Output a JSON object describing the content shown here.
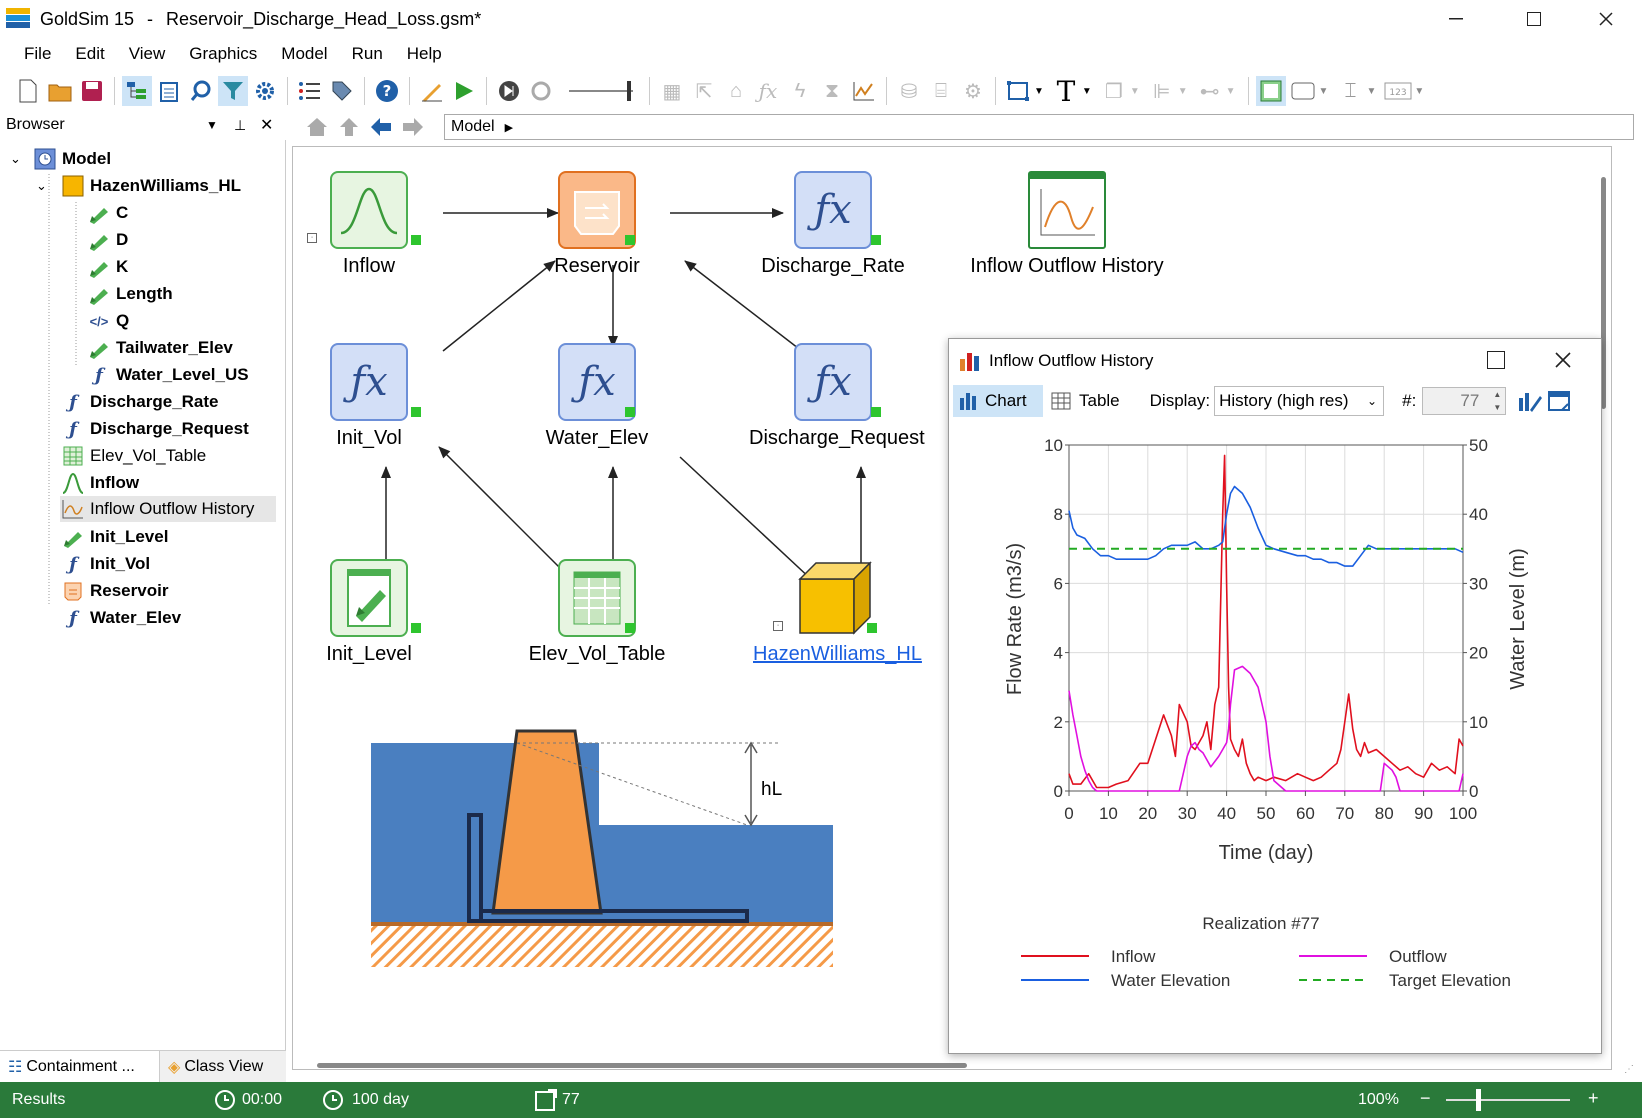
{
  "window": {
    "app_title": "GoldSim 15",
    "file": "Reservoir_Discharge_Head_Loss.gsm*"
  },
  "menu": [
    "File",
    "Edit",
    "View",
    "Graphics",
    "Model",
    "Run",
    "Help"
  ],
  "browser": {
    "title": "Browser",
    "tree": [
      {
        "label": "Model",
        "level": 0,
        "icon": "model-icon",
        "bold": true
      },
      {
        "label": "HazenWilliams_HL",
        "level": 1,
        "icon": "container-icon",
        "bold": true
      },
      {
        "label": "C",
        "level": 2,
        "icon": "data-pencil-icon",
        "bold": true
      },
      {
        "label": "D",
        "level": 2,
        "icon": "data-pencil-icon",
        "bold": true
      },
      {
        "label": "K",
        "level": 2,
        "icon": "data-pencil-icon",
        "bold": true
      },
      {
        "label": "Length",
        "level": 2,
        "icon": "data-pencil-icon",
        "bold": true
      },
      {
        "label": "Q",
        "level": 2,
        "icon": "script-icon",
        "bold": true
      },
      {
        "label": "Tailwater_Elev",
        "level": 2,
        "icon": "data-pencil-icon",
        "bold": true
      },
      {
        "label": "Water_Level_US",
        "level": 2,
        "icon": "expression-icon",
        "bold": true
      },
      {
        "label": "Discharge_Rate",
        "level": 1,
        "icon": "expression-icon",
        "bold": true
      },
      {
        "label": "Discharge_Request",
        "level": 1,
        "icon": "expression-icon",
        "bold": true
      },
      {
        "label": "Elev_Vol_Table",
        "level": 1,
        "icon": "table-icon",
        "bold": false
      },
      {
        "label": "Inflow",
        "level": 1,
        "icon": "timeseries-icon",
        "bold": true
      },
      {
        "label": "Inflow Outflow History",
        "level": 1,
        "icon": "chart-icon",
        "bold": false,
        "selected": true
      },
      {
        "label": "Init_Level",
        "level": 1,
        "icon": "data-pencil-icon",
        "bold": true
      },
      {
        "label": "Init_Vol",
        "level": 1,
        "icon": "expression-icon",
        "bold": true
      },
      {
        "label": "Reservoir",
        "level": 1,
        "icon": "reservoir-icon",
        "bold": true
      },
      {
        "label": "Water_Elev",
        "level": 1,
        "icon": "expression-icon",
        "bold": true
      }
    ],
    "tabs": [
      "Containment ...",
      "Class View"
    ]
  },
  "breadcrumb": "Model",
  "elements": {
    "inflow": "Inflow",
    "reservoir": "Reservoir",
    "discharge_rate": "Discharge_Rate",
    "history": "Inflow Outflow History",
    "init_vol": "Init_Vol",
    "water_elev": "Water_Elev",
    "discharge_request": "Discharge_Request",
    "init_level": "Init_Level",
    "elev_vol_table": "Elev_Vol_Table",
    "hazen": "HazenWilliams_HL"
  },
  "diagram_label": "hL",
  "chart_window": {
    "title": "Inflow Outflow History",
    "tab_chart": "Chart",
    "tab_table": "Table",
    "display_label": "Display:",
    "display_value": "History (high res)",
    "realization_label": "#:",
    "realization_value": "77"
  },
  "chart_data": {
    "type": "line",
    "xlabel": "Time (day)",
    "ylabel": "Flow Rate (m3/s)",
    "y2label": "Water Level (m)",
    "subtitle": "Realization #77",
    "xlim": [
      0,
      100
    ],
    "ylim": [
      0,
      10
    ],
    "y2lim": [
      0,
      50
    ],
    "xticks": [
      0,
      10,
      20,
      30,
      40,
      50,
      60,
      70,
      80,
      90,
      100
    ],
    "yticks": [
      0,
      2,
      4,
      6,
      8,
      10
    ],
    "y2ticks": [
      0,
      10,
      20,
      30,
      40,
      50
    ],
    "grid": true,
    "series": [
      {
        "name": "Inflow",
        "axis": "left",
        "color": "#e0101e",
        "dash": false,
        "x": [
          0,
          1,
          3,
          5,
          7,
          10,
          12,
          15,
          18,
          20,
          22,
          24,
          26,
          27,
          28,
          30,
          31,
          32,
          34,
          35,
          36,
          37,
          38,
          38.5,
          39,
          39.5,
          40,
          40.5,
          41,
          42,
          43,
          44,
          45,
          46,
          47,
          48,
          50,
          52,
          55,
          58,
          60,
          62,
          64,
          66,
          68,
          69,
          70,
          71,
          72,
          73,
          74,
          75,
          76,
          78,
          80,
          82,
          84,
          86,
          88,
          90,
          92,
          94,
          96,
          98,
          99,
          100
        ],
        "y": [
          0.5,
          0.2,
          0.2,
          0.5,
          0.1,
          0.1,
          0.2,
          0.3,
          0.8,
          0.8,
          1.5,
          2.2,
          1.6,
          1.0,
          2.5,
          2.0,
          1.3,
          1.2,
          1.6,
          2.0,
          1.2,
          2.5,
          3.0,
          5.5,
          8.0,
          9.7,
          6.0,
          3.0,
          1.5,
          1.2,
          1.0,
          1.5,
          0.8,
          0.5,
          0.3,
          0.4,
          0.3,
          0.4,
          0.3,
          0.5,
          0.4,
          0.3,
          0.4,
          0.6,
          0.8,
          1.2,
          2.0,
          2.8,
          1.8,
          1.2,
          1.0,
          1.4,
          1.1,
          1.2,
          1.0,
          0.8,
          0.6,
          0.7,
          0.5,
          0.4,
          0.8,
          0.6,
          0.7,
          0.5,
          1.5,
          1.3
        ]
      },
      {
        "name": "Outflow",
        "axis": "left",
        "color": "#e010e0",
        "dash": false,
        "x": [
          0,
          1,
          2,
          3,
          4,
          5,
          6,
          7,
          10,
          15,
          20,
          22,
          23,
          24,
          26,
          28,
          30,
          31,
          32,
          33,
          34,
          36,
          38,
          39,
          40,
          40.5,
          41,
          42,
          44,
          46,
          48,
          49,
          50,
          51,
          52,
          55,
          60,
          65,
          70,
          72,
          73,
          74,
          76,
          78,
          79,
          80,
          82,
          83,
          84,
          86,
          88,
          90,
          92,
          94,
          96,
          98,
          99,
          100
        ],
        "y": [
          2.9,
          2.2,
          1.6,
          1.0,
          0.6,
          0.3,
          0.1,
          0.0,
          0.0,
          0.0,
          0.0,
          0.0,
          0.0,
          0.0,
          0.0,
          0.0,
          1.0,
          1.3,
          1.4,
          1.2,
          1.1,
          0.7,
          1.0,
          1.2,
          1.4,
          1.8,
          2.5,
          3.5,
          3.6,
          3.4,
          3.0,
          2.5,
          2.0,
          1.0,
          0.3,
          0.0,
          0.0,
          0.0,
          0.0,
          0.0,
          0.0,
          0.0,
          0.0,
          0.0,
          0.0,
          0.8,
          0.6,
          0.4,
          0.0,
          0.0,
          0.0,
          0.0,
          0.0,
          0.0,
          0.0,
          0.0,
          0.0,
          0.5
        ]
      },
      {
        "name": "Water Elevation",
        "axis": "right",
        "color": "#1a5fe0",
        "dash": false,
        "x": [
          0,
          1,
          2,
          4,
          6,
          8,
          10,
          12,
          14,
          16,
          18,
          20,
          22,
          24,
          26,
          28,
          30,
          32,
          34,
          36,
          38,
          39,
          40,
          41,
          42,
          44,
          46,
          48,
          50,
          52,
          55,
          58,
          60,
          62,
          64,
          66,
          68,
          70,
          72,
          74,
          76,
          78,
          80,
          82,
          84,
          86,
          88,
          90,
          92,
          94,
          96,
          98,
          100
        ],
        "y": [
          40.5,
          38,
          37,
          36.5,
          35,
          34,
          34,
          33.5,
          33.5,
          33.5,
          33.5,
          33.5,
          34,
          35,
          35.5,
          35.5,
          35.5,
          36,
          35,
          35,
          35.5,
          36,
          40,
          43,
          44,
          43,
          41,
          38,
          35.5,
          35,
          34.5,
          34,
          34,
          33.5,
          33.5,
          33,
          33,
          32.5,
          32.5,
          34,
          35.5,
          35,
          35,
          35,
          35,
          35,
          35,
          35,
          35,
          35,
          35,
          35,
          34.5
        ]
      },
      {
        "name": "Target Elevation",
        "axis": "right",
        "color": "#22aa22",
        "dash": true,
        "x": [
          0,
          100
        ],
        "y": [
          35,
          35
        ]
      }
    ]
  },
  "status": {
    "label": "Results",
    "time": "00:00",
    "duration": "100 day",
    "realizations": "77",
    "zoom": "100%"
  },
  "colors": {
    "statusbar": "#2a7a3a",
    "accent": "#1a5fe0",
    "water": "#4a7fc0",
    "dam": "#f59a48"
  }
}
